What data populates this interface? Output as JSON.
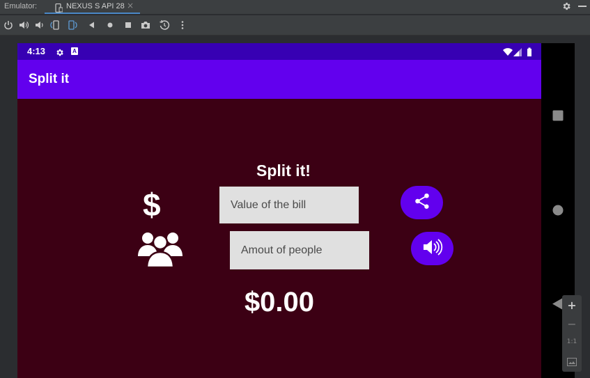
{
  "ide": {
    "emulator_label": "Emulator:",
    "device_tab": "NEXUS S API 28",
    "toolbar_icons": [
      "power-icon",
      "volume-up-icon",
      "volume-down-icon",
      "rotate-left-icon",
      "rotate-right-icon",
      "back-icon",
      "home-icon",
      "overview-icon",
      "screenshot-icon",
      "snapshot-icon",
      "more-icon"
    ]
  },
  "status_bar": {
    "time": "4:13",
    "badge": "A"
  },
  "app": {
    "title": "Split it",
    "headline": "Split it!",
    "dollar_symbol": "$",
    "bill_placeholder": "Value of the bill",
    "people_placeholder": "Amout of people",
    "total": "$0.00",
    "share_icon": "share-icon",
    "speak_icon": "speaker-icon"
  },
  "zoom": {
    "plus": "+",
    "minus": "−",
    "ratio": "1:1"
  },
  "colors": {
    "status_bar": "#3700b3",
    "app_bar": "#6200ee",
    "background": "#3c0014",
    "fab": "#6200ee",
    "field": "#e0e0e0"
  }
}
